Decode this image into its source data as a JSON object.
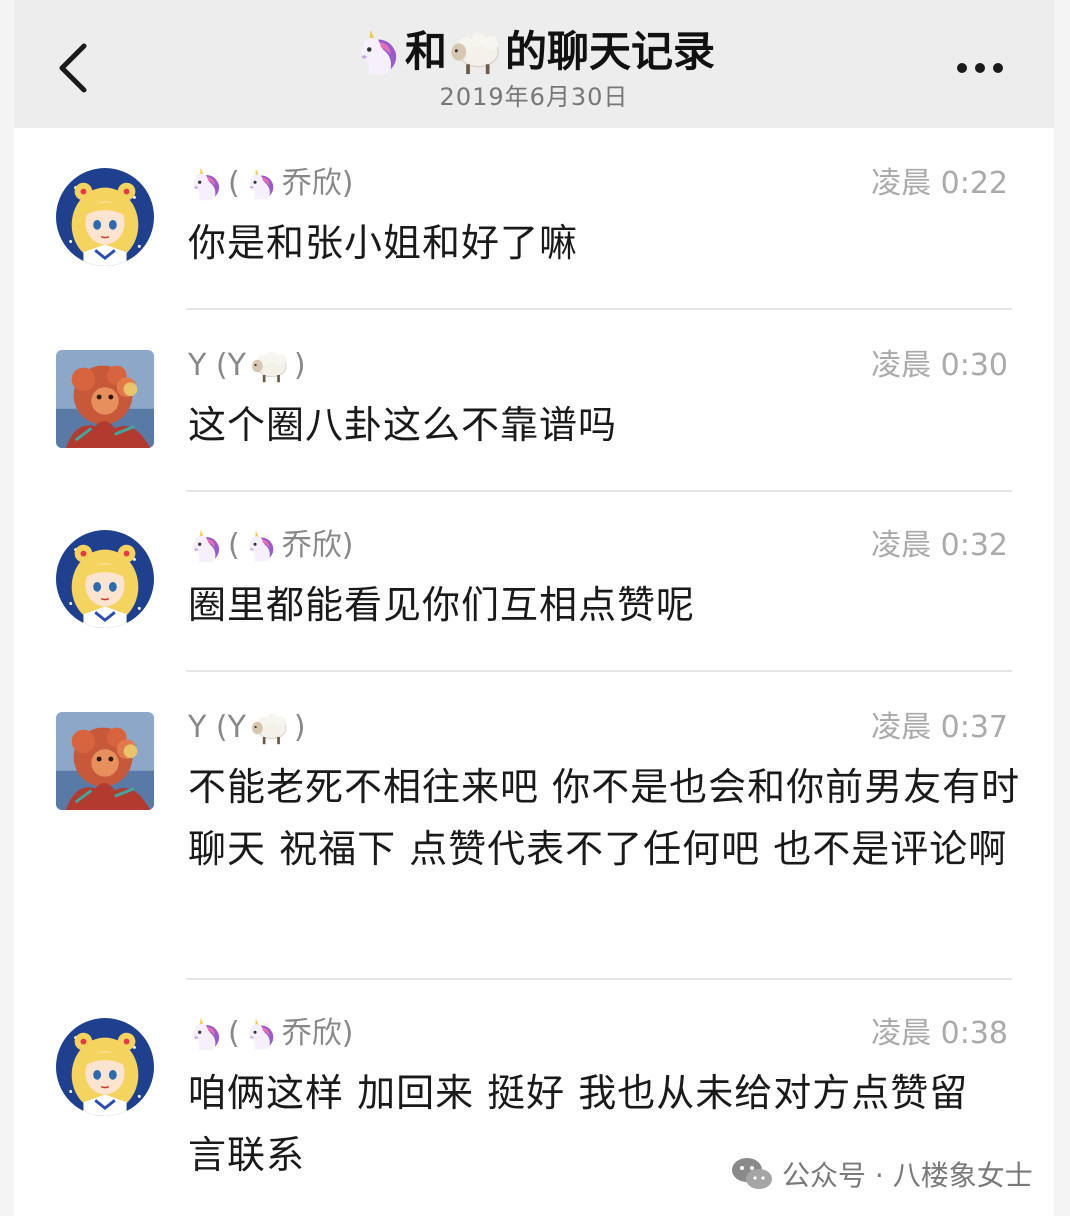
{
  "header": {
    "title_left": "和",
    "title_right": "的聊天记录",
    "date": "2019年6月30日"
  },
  "messages": [
    {
      "sender_paren_name": "乔欣)",
      "avatar": "sailor-moon-avatar",
      "time": "凌晨 0:22",
      "text": "你是和张小姐和好了嘛"
    },
    {
      "sender_prefix": "Y (Y",
      "avatar": "teddy-bear-avatar",
      "time": "凌晨 0:30",
      "text": "这个圈八卦这么不靠谱吗"
    },
    {
      "sender_paren_name": "乔欣)",
      "avatar": "sailor-moon-avatar",
      "time": "凌晨 0:32",
      "text": "圈里都能看见你们互相点赞呢"
    },
    {
      "sender_prefix": "Y (Y",
      "avatar": "teddy-bear-avatar",
      "time": "凌晨 0:37",
      "text": "不能老死不相往来吧 你不是也会和你前男友有时聊天 祝福下 点赞代表不了任何吧 也不是评论啊"
    },
    {
      "sender_paren_name": "乔欣)",
      "avatar": "sailor-moon-avatar",
      "time": "凌晨 0:38",
      "text": "咱俩这样 加回来 挺好  我也从未给对方点赞留言联系"
    }
  ],
  "watermark": {
    "text": "公众号 · 八楼象女士"
  },
  "icons": {
    "back": "chevron-left-icon",
    "more": "more-dots-icon",
    "unicorn": "unicorn-emoji-icon",
    "sheep": "sheep-emoji-icon",
    "wechat": "wechat-logo-icon"
  },
  "colors": {
    "header_bg": "#ededed",
    "page_bg": "#ffffff",
    "meta_text": "#888888",
    "time_text": "#aaaaaa",
    "body_text": "#1a1a1a"
  }
}
